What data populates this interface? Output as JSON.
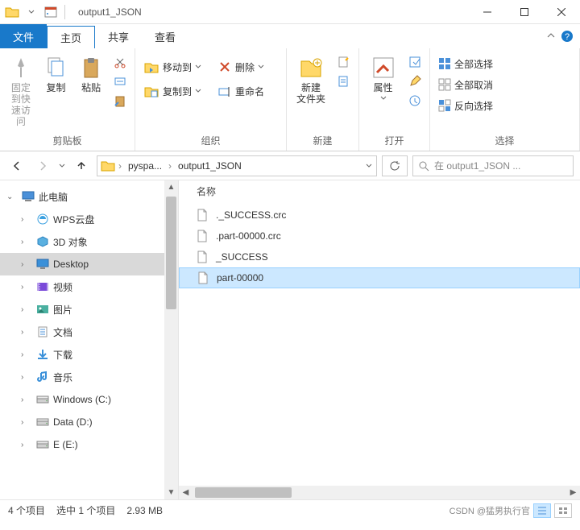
{
  "titlebar": {
    "title": "output1_JSON"
  },
  "tabs": {
    "file": "文件",
    "home": "主页",
    "share": "共享",
    "view": "查看"
  },
  "ribbon": {
    "clipboard": {
      "label": "剪贴板",
      "pin": "固定到快速访问",
      "copy": "复制",
      "paste": "粘贴"
    },
    "organize": {
      "label": "组织",
      "moveTo": "移动到",
      "copyTo": "复制到",
      "delete": "删除",
      "rename": "重命名"
    },
    "new": {
      "label": "新建",
      "newFolder": "新建\n文件夹"
    },
    "open": {
      "label": "打开",
      "properties": "属性"
    },
    "select": {
      "label": "选择",
      "selectAll": "全部选择",
      "selectNone": "全部取消",
      "invert": "反向选择"
    }
  },
  "nav": {
    "crumb1": "pyspa...",
    "crumb2": "output1_JSON",
    "searchPlaceholder": "在 output1_JSON ..."
  },
  "tree": {
    "root": "此电脑",
    "items": [
      {
        "label": "WPS云盘",
        "icon": "wps"
      },
      {
        "label": "3D 对象",
        "icon": "3d"
      },
      {
        "label": "Desktop",
        "icon": "desktop",
        "selected": true
      },
      {
        "label": "视频",
        "icon": "video"
      },
      {
        "label": "图片",
        "icon": "pictures"
      },
      {
        "label": "文档",
        "icon": "documents"
      },
      {
        "label": "下载",
        "icon": "downloads"
      },
      {
        "label": "音乐",
        "icon": "music"
      },
      {
        "label": "Windows (C:)",
        "icon": "drive"
      },
      {
        "label": "Data (D:)",
        "icon": "drive"
      },
      {
        "label": "E (E:)",
        "icon": "drive"
      }
    ]
  },
  "files": {
    "header": "名称",
    "items": [
      {
        "name": "._SUCCESS.crc"
      },
      {
        "name": ".part-00000.crc"
      },
      {
        "name": "_SUCCESS"
      },
      {
        "name": "part-00000",
        "selected": true
      }
    ]
  },
  "status": {
    "count": "4 个项目",
    "selection": "选中 1 个项目",
    "size": "2.93 MB",
    "watermark": "CSDN @猛男执行官"
  }
}
